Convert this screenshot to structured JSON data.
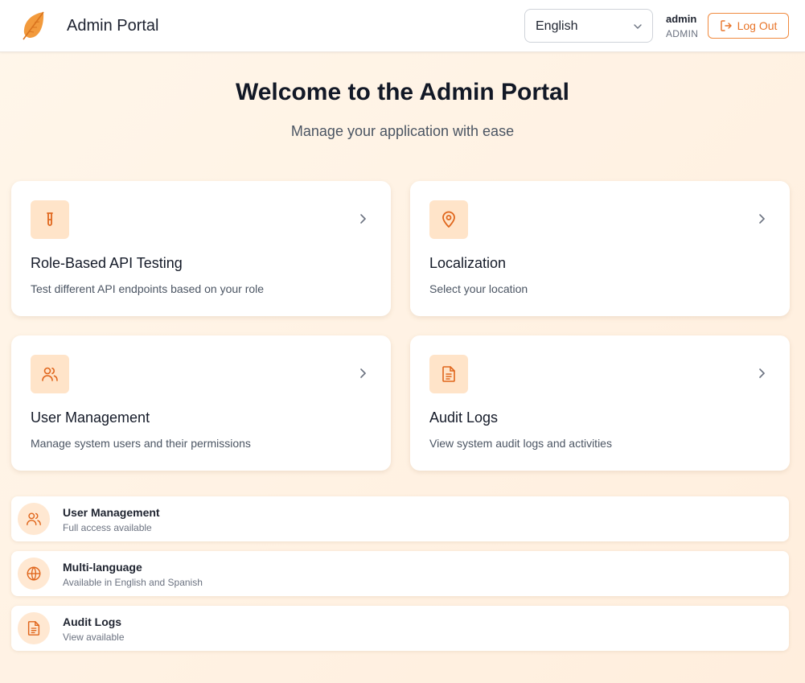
{
  "header": {
    "app_title": "Admin Portal",
    "language": {
      "selected": "English"
    },
    "user": {
      "name": "admin",
      "role": "ADMIN"
    },
    "logout_label": "Log Out"
  },
  "hero": {
    "title": "Welcome to the Admin Portal",
    "subtitle": "Manage your application with ease"
  },
  "cards": [
    {
      "title": "Role-Based API Testing",
      "description": "Test different API endpoints based on your role",
      "icon": "test-tube-icon"
    },
    {
      "title": "Localization",
      "description": "Select your location",
      "icon": "map-pin-icon"
    },
    {
      "title": "User Management",
      "description": "Manage system users and their permissions",
      "icon": "users-icon"
    },
    {
      "title": "Audit Logs",
      "description": "View system audit logs and activities",
      "icon": "file-text-icon"
    }
  ],
  "features": [
    {
      "title": "User Management",
      "status": "Full access available",
      "icon": "users-icon"
    },
    {
      "title": "Multi-language",
      "status": "Available in English and Spanish",
      "icon": "globe-icon"
    },
    {
      "title": "Audit Logs",
      "status": "View available",
      "icon": "file-text-icon"
    }
  ],
  "colors": {
    "accent": "#e8752a",
    "icon_bg": "#ffe4c9",
    "page_bg": "#fff3e6"
  }
}
